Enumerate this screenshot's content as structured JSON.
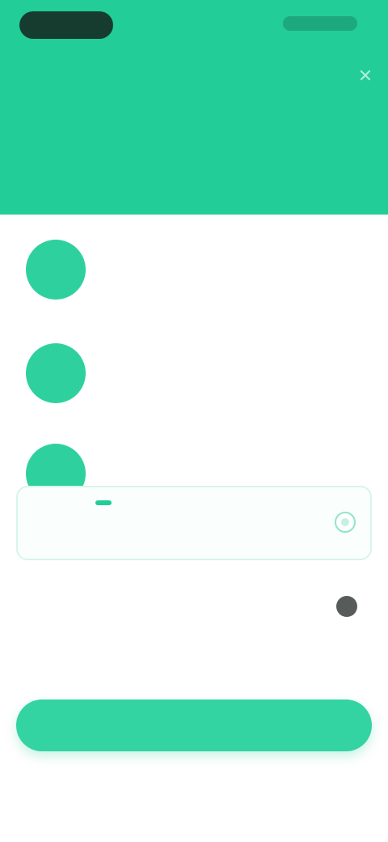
{
  "status_bar": {
    "left_pill": "",
    "right_indicators": ""
  },
  "header": {
    "close_icon": "close-icon",
    "title": "",
    "subtitle": ""
  },
  "features": [
    {
      "icon": "feature-icon",
      "title": "",
      "description": ""
    },
    {
      "icon": "feature-icon",
      "title": "",
      "description": ""
    },
    {
      "icon": "feature-icon",
      "title": "",
      "description": ""
    }
  ],
  "plans": [
    {
      "name": "",
      "badge": "",
      "price": "",
      "period": "",
      "selected": true
    },
    {
      "name": "",
      "badge": "",
      "price": "",
      "period": "",
      "selected": false
    }
  ],
  "terms_text": "",
  "cta_label": "",
  "restore_label": "",
  "colors": {
    "accent": "#22cd97",
    "button": "#33d3a2",
    "text_dark": "#34403d",
    "text_muted": "#9aa9a5"
  }
}
